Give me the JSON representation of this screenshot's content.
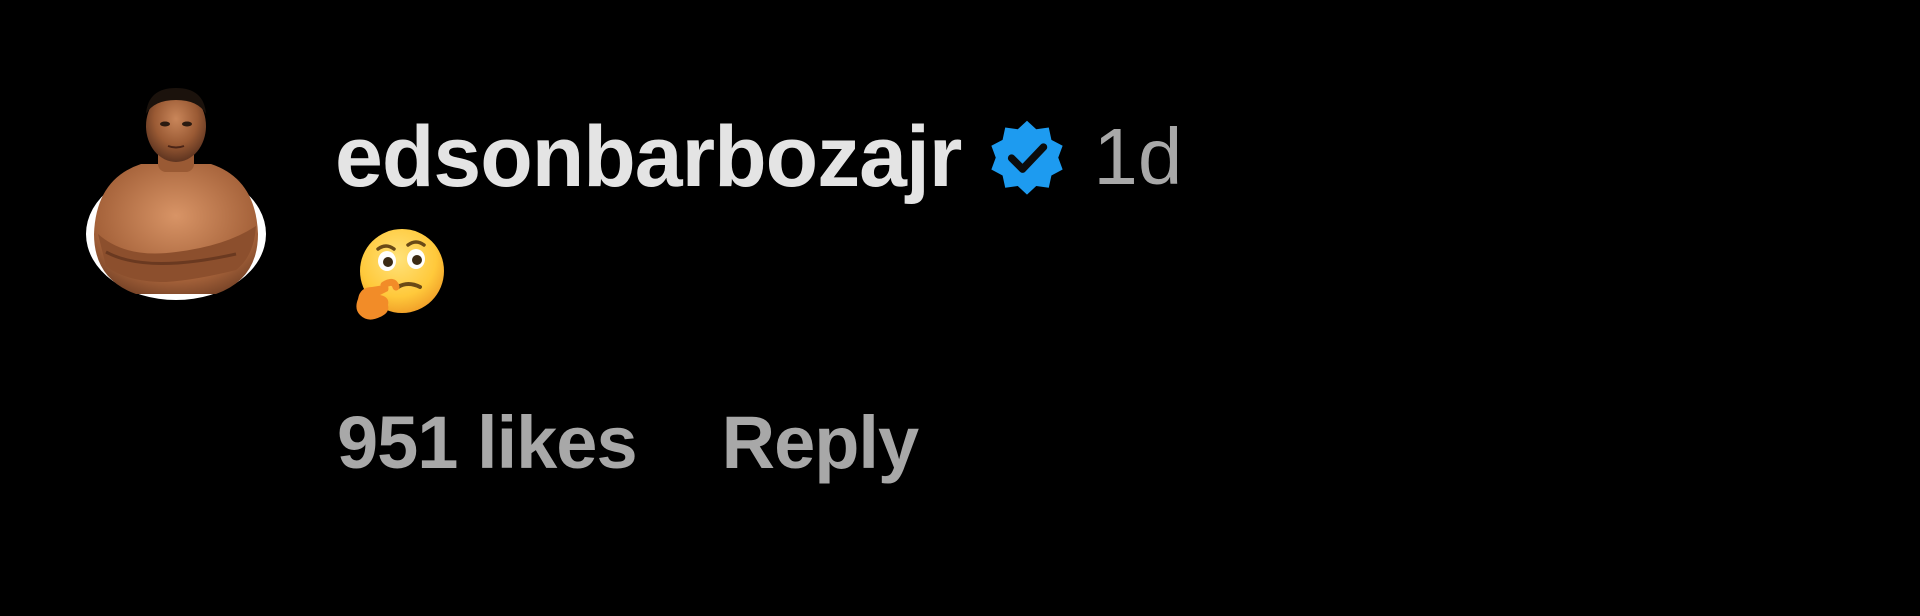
{
  "comment": {
    "avatar": {
      "icon": "avatar-photo",
      "alt": "Avatar"
    },
    "username": "edsonbarbozajr",
    "verified_icon": "verified-badge-icon",
    "verified_color": "#1d9bf0",
    "timestamp": "1d",
    "body_emoji": "thinking-face-emoji",
    "likes_label": "951 likes",
    "reply_label": "Reply"
  }
}
